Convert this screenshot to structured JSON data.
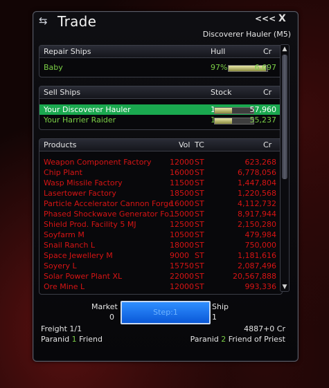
{
  "window": {
    "title": "Trade",
    "collapse_label": "<<<",
    "close_label": "X",
    "subtitle": "Discoverer Hauler (M5)"
  },
  "repair": {
    "header": {
      "name": "Repair Ships",
      "col1": "Hull",
      "col2": "Cr"
    },
    "rows": [
      {
        "name": "Baby",
        "hull": "97%",
        "hull_fraction": 0.97,
        "price": "6,697"
      }
    ]
  },
  "sell": {
    "header": {
      "name": "Sell Ships",
      "col1": "Stock",
      "col2": "Cr"
    },
    "rows": [
      {
        "name": "Your Discoverer Hauler",
        "stock": "1",
        "stock_fraction": 0.45,
        "price": "57,960"
      },
      {
        "name": "Your Harrier Raider",
        "stock": "1",
        "stock_fraction": 0.45,
        "price": "55,237"
      }
    ]
  },
  "products": {
    "header": {
      "name": "Products",
      "vol": "Vol",
      "tc": "TC",
      "cr": "Cr"
    },
    "rows": [
      {
        "name": "Weapon Component Factory",
        "vol": "12000",
        "tc": "ST",
        "price": "623,268"
      },
      {
        "name": "Chip Plant",
        "vol": "16000",
        "tc": "ST",
        "price": "6,778,056"
      },
      {
        "name": "Wasp Missile Factory",
        "vol": "11500",
        "tc": "ST",
        "price": "1,447,804"
      },
      {
        "name": "Lasertower Factory",
        "vol": "18500",
        "tc": "ST",
        "price": "1,220,568"
      },
      {
        "name": "Particle Accelerator Cannon Forge",
        "vol": "16000",
        "tc": "ST",
        "price": "4,112,732"
      },
      {
        "name": "Phased Shockwave Generator Fo...",
        "vol": "15000",
        "tc": "ST",
        "price": "8,917,944"
      },
      {
        "name": "Shield Prod. Facility 5 MJ",
        "vol": "12500",
        "tc": "ST",
        "price": "2,150,280"
      },
      {
        "name": "Soyfarm M",
        "vol": "10500",
        "tc": "ST",
        "price": "479,984"
      },
      {
        "name": "Snail Ranch L",
        "vol": "18000",
        "tc": "ST",
        "price": "750,000"
      },
      {
        "name": "Space Jewellery M",
        "vol": "9000",
        "tc": "ST",
        "price": "1,181,616"
      },
      {
        "name": "Soyery L",
        "vol": "15750",
        "tc": "ST",
        "price": "2,087,496"
      },
      {
        "name": "Solar Power Plant XL",
        "vol": "22000",
        "tc": "ST",
        "price": "20,567,888"
      },
      {
        "name": "Ore Mine L",
        "vol": "12000",
        "tc": "ST",
        "price": "993,336"
      }
    ]
  },
  "trade": {
    "market_label": "Market",
    "market_value": "0",
    "ship_label": "Ship",
    "ship_value": "1",
    "step_label": "Step:1",
    "freight": "Freight 1/1",
    "credits": "4887+0 Cr",
    "left_faction": "Paranid",
    "left_rep_num": "1",
    "left_rep_text": "Friend",
    "right_faction": "Paranid",
    "right_rep_num": "2",
    "right_rep_text": "Friend of Priest"
  },
  "icons": {
    "app": "trade-arrows-icon",
    "scroll_up": "chevron-up-icon",
    "scroll_down": "chevron-down-icon"
  },
  "colors": {
    "selected_row": "#1aa84f",
    "owned_item": "#7bcf46",
    "product_item": "#d81414",
    "step_button": "#0a58d8"
  }
}
